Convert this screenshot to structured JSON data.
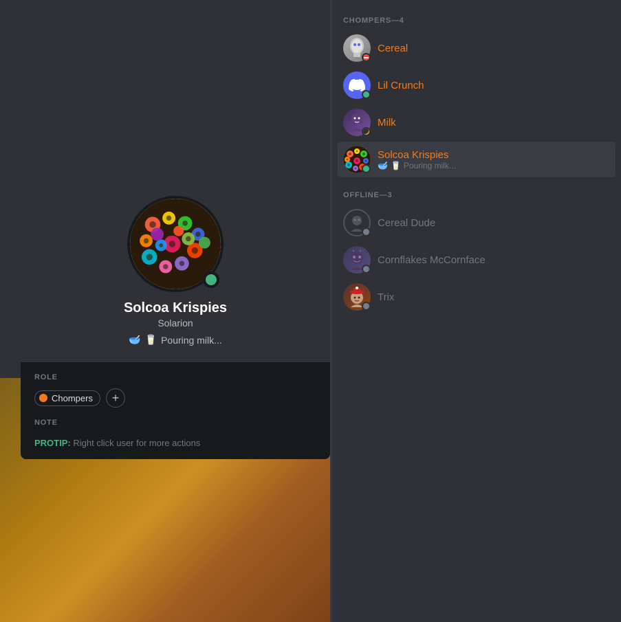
{
  "leftBg": {
    "visible": true
  },
  "profileCard": {
    "name": "Solcoa Krispies",
    "username": "Solarion",
    "statusEmoji1": "🥣",
    "statusEmoji2": "🥛",
    "statusText": "Pouring milk...",
    "roleSectionLabel": "ROLE",
    "roleName": "Chompers",
    "addRoleLabel": "+",
    "noteSectionLabel": "NOTE",
    "protipLabel": "PROTIP:",
    "protipText": " Right click user for more actions"
  },
  "memberList": {
    "onlineCategoryLabel": "CHOMPERS—4",
    "offlineCategoryLabel": "OFFLINE—3",
    "onlineMembers": [
      {
        "name": "Cereal",
        "status": "dnd",
        "avatarType": "cereal-bag"
      },
      {
        "name": "Lil Crunch",
        "status": "online",
        "avatarType": "discord"
      },
      {
        "name": "Milk",
        "status": "idle",
        "avatarType": "purple-char"
      },
      {
        "name": "Solcoa Krispies",
        "status": "online",
        "avatarType": "cereal-bowl",
        "subEmoji1": "🥣",
        "subEmoji2": "🥛",
        "subText": "Pouring milk...",
        "active": true
      }
    ],
    "offlineMembers": [
      {
        "name": "Cereal Dude",
        "status": "offline",
        "avatarType": "dark-default"
      },
      {
        "name": "Cornflakes McCornface",
        "status": "offline",
        "avatarType": "dragon"
      },
      {
        "name": "Trix",
        "status": "offline",
        "avatarType": "red-hat"
      }
    ]
  }
}
